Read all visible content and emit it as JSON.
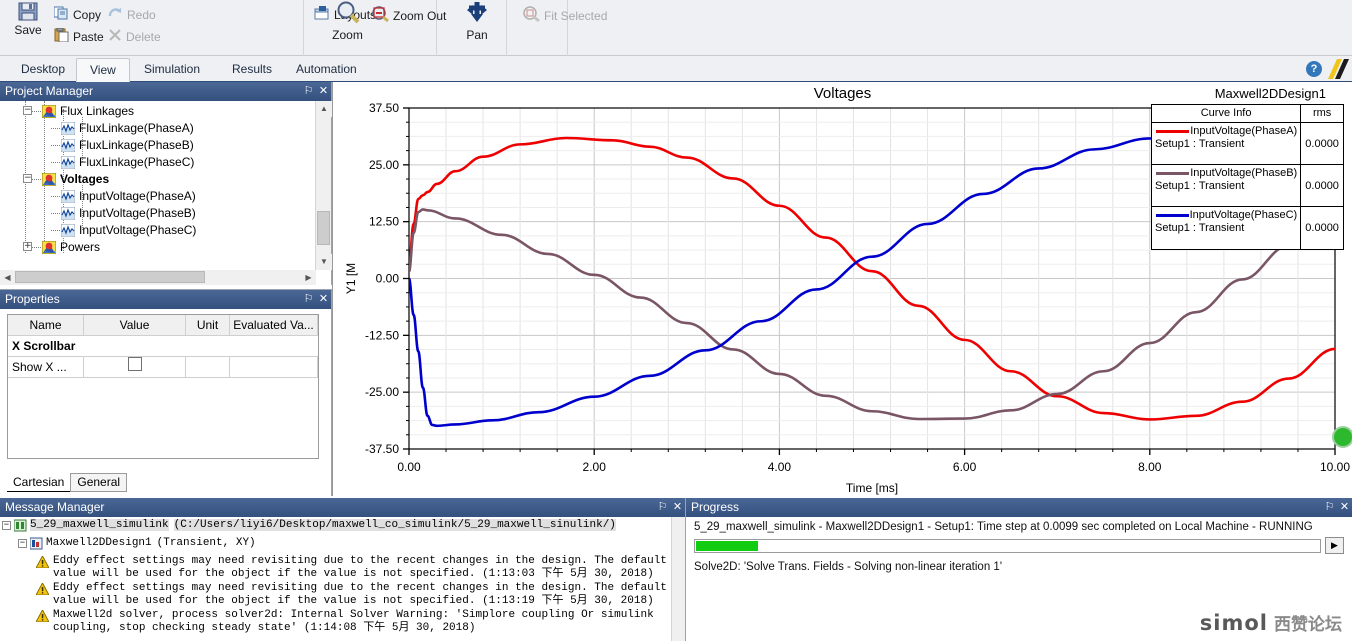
{
  "ribbon": {
    "groups": [
      {
        "name": "clipboard",
        "items": [
          {
            "label": "Save",
            "icon": "save-icon",
            "disabled": false
          },
          {
            "label": "Copy",
            "icon": "copy-icon",
            "disabled": false
          },
          {
            "label": "Redo",
            "icon": "redo-icon",
            "disabled": true
          },
          {
            "label": "Paste",
            "icon": "paste-icon",
            "disabled": false
          },
          {
            "label": "Delete",
            "icon": "delete-icon",
            "disabled": true
          }
        ]
      },
      {
        "name": "layouts",
        "items": [
          {
            "label": "Layouts",
            "icon": "layouts-icon",
            "disabled": false
          }
        ]
      },
      {
        "name": "view",
        "items": [
          {
            "label": "Zoom",
            "icon": "zoom-icon",
            "disabled": false
          },
          {
            "label": "Zoom Out",
            "icon": "zoom-out-icon",
            "disabled": false
          },
          {
            "label": "Pan",
            "icon": "pan-icon",
            "disabled": false
          },
          {
            "label": "Fit Selected",
            "icon": "fit-selected-icon",
            "disabled": true
          }
        ]
      }
    ]
  },
  "tabs": {
    "items": [
      "Desktop",
      "View",
      "Simulation",
      "Results",
      "Automation"
    ],
    "active": "View",
    "help_glyph": "?"
  },
  "project_manager": {
    "title": "Project Manager",
    "pin_glyph": "⚐",
    "close_glyph": "✕",
    "tree": [
      {
        "label": "Flux Linkages",
        "type": "folder",
        "expander": "−",
        "depth": 2,
        "bold": false
      },
      {
        "label": "FluxLinkage(PhaseA)",
        "type": "curve",
        "expander": "",
        "depth": 3,
        "bold": false
      },
      {
        "label": "FluxLinkage(PhaseB)",
        "type": "curve",
        "expander": "",
        "depth": 3,
        "bold": false
      },
      {
        "label": "FluxLinkage(PhaseC)",
        "type": "curve",
        "expander": "",
        "depth": 3,
        "bold": false
      },
      {
        "label": "Voltages",
        "type": "folder",
        "expander": "−",
        "depth": 2,
        "bold": true
      },
      {
        "label": "InputVoltage(PhaseA)",
        "type": "curve",
        "expander": "",
        "depth": 3,
        "bold": false
      },
      {
        "label": "InputVoltage(PhaseB)",
        "type": "curve",
        "expander": "",
        "depth": 3,
        "bold": false
      },
      {
        "label": "InputVoltage(PhaseC)",
        "type": "curve",
        "expander": "",
        "depth": 3,
        "bold": false
      },
      {
        "label": "Powers",
        "type": "folder",
        "expander": "+",
        "depth": 2,
        "bold": false
      }
    ]
  },
  "properties": {
    "title": "Properties",
    "pin_glyph": "⚐",
    "close_glyph": "✕",
    "columns": [
      "Name",
      "Value",
      "Unit",
      "Evaluated Va..."
    ],
    "section": "X Scrollbar",
    "rows": [
      {
        "name": "Show X ...",
        "value": "",
        "unit": "",
        "evaluated": "",
        "checkbox": true,
        "checked": false
      }
    ],
    "tabs": [
      "Cartesian",
      "General"
    ],
    "active_tab": "Cartesian"
  },
  "plot": {
    "design_name": "Maxwell2DDesign1",
    "legend": {
      "col_curve": "Curve Info",
      "col_rms": "rms",
      "rows": [
        {
          "name": "InputVoltage(PhaseA)",
          "setup": "Setup1 : Transient",
          "rms": "0.0000",
          "color": "#ee0000"
        },
        {
          "name": "InputVoltage(PhaseB)",
          "setup": "Setup1 : Transient",
          "rms": "0.0000",
          "color": "#7a5566"
        },
        {
          "name": "InputVoltage(PhaseC)",
          "setup": "Setup1 : Transient",
          "rms": "0.0000",
          "color": "#0000cc"
        }
      ]
    }
  },
  "chart_data": {
    "type": "line",
    "title": "Voltages",
    "xlabel": "Time [ms]",
    "ylabel": "Y1 [M",
    "xlim": [
      0.0,
      10.0
    ],
    "ylim": [
      -37.5,
      37.5
    ],
    "xticks": [
      "0.00",
      "2.00",
      "4.00",
      "6.00",
      "8.00",
      "10.00"
    ],
    "yticks": [
      "37.50",
      "25.00",
      "12.50",
      "0.00",
      "-12.50",
      "-25.00",
      "-37.50"
    ],
    "xtick_values": [
      0,
      2,
      4,
      6,
      8,
      10
    ],
    "ytick_values": [
      37.5,
      25,
      12.5,
      0,
      -12.5,
      -25,
      -37.5
    ],
    "grid": true,
    "legend_position": "top-right",
    "minor_ticks_x": 5,
    "minor_ticks_y": 4,
    "series": [
      {
        "name": "InputVoltage(PhaseA)",
        "color": "#ee0000",
        "amplitude": 31.0,
        "period_ms": 10.0,
        "phase_deg": 0,
        "x": [
          0.0,
          0.05,
          0.1,
          0.15,
          0.2,
          0.3,
          0.5,
          0.8,
          1.2,
          1.7,
          2.2,
          2.6,
          3.0,
          3.5,
          4.0,
          4.5,
          5.0,
          5.5,
          6.0,
          6.5,
          7.0,
          7.5,
          8.0,
          8.5,
          9.0,
          9.5,
          10.0
        ],
        "y": [
          3.2,
          12.0,
          17.5,
          18.3,
          19.0,
          20.8,
          23.6,
          26.8,
          29.5,
          30.9,
          30.4,
          29.0,
          26.6,
          22.0,
          16.0,
          9.0,
          1.6,
          -6.0,
          -13.5,
          -20.4,
          -25.9,
          -29.6,
          -31.0,
          -30.2,
          -27.1,
          -22.0,
          -15.5
        ]
      },
      {
        "name": "InputVoltage(PhaseB)",
        "color": "#7a5566",
        "amplitude": 31.0,
        "period_ms": 10.0,
        "phase_deg": -120,
        "x": [
          0.0,
          0.05,
          0.1,
          0.15,
          0.2,
          0.5,
          1.0,
          1.5,
          2.0,
          2.5,
          3.0,
          3.5,
          4.0,
          4.5,
          5.0,
          5.5,
          6.0,
          6.5,
          7.0,
          7.5,
          8.0,
          8.5,
          9.0,
          9.5,
          10.0
        ],
        "y": [
          1.5,
          10.0,
          14.6,
          15.2,
          15.0,
          13.2,
          9.6,
          5.4,
          0.8,
          -4.2,
          -9.8,
          -15.6,
          -21.0,
          -25.8,
          -29.2,
          -30.9,
          -30.8,
          -29.0,
          -25.4,
          -20.4,
          -14.2,
          -7.4,
          -0.2,
          7.2,
          14.2
        ]
      },
      {
        "name": "InputVoltage(PhaseC)",
        "color": "#0000cc",
        "amplitude": 31.0,
        "period_ms": 10.0,
        "phase_deg": 120,
        "x": [
          0.0,
          0.05,
          0.1,
          0.15,
          0.2,
          0.25,
          0.3,
          0.5,
          0.9,
          1.4,
          2.0,
          2.6,
          3.2,
          3.8,
          4.4,
          5.0,
          5.6,
          6.2,
          6.8,
          7.4,
          8.0,
          8.6,
          9.2,
          9.6,
          10.0
        ],
        "y": [
          0.0,
          -8.0,
          -16.0,
          -24.0,
          -30.2,
          -32.2,
          -32.4,
          -32.1,
          -31.2,
          -29.4,
          -26.0,
          -21.4,
          -15.8,
          -9.4,
          -2.4,
          4.8,
          12.0,
          18.6,
          24.2,
          28.4,
          30.8,
          31.0,
          29.4,
          27.4,
          24.4
        ]
      }
    ]
  },
  "message_manager": {
    "title": "Message Manager",
    "pin_glyph": "⚐",
    "close_glyph": "✕",
    "root": {
      "expander": "−",
      "name": "5_29_maxwell_simulink",
      "path": "(C:/Users/liyi6/Desktop/maxwell_co_simulink/5_29_maxwell_sinulink/)"
    },
    "design": {
      "expander": "−",
      "name": "Maxwell2DDesign1",
      "detail": "(Transient, XY)"
    },
    "messages": [
      {
        "icon": "warning-icon",
        "line1": "Eddy effect settings may need revisiting due to the recent changes in the design.  The default",
        "line2": "value will be used for the object if the value is not specified.  (1:13:03 下午  5月 30, 2018)"
      },
      {
        "icon": "warning-icon",
        "line1": "Eddy effect settings may need revisiting due to the recent changes in the design.  The default",
        "line2": "value will be used for the object if the value is not specified.  (1:13:19 下午  5月 30, 2018)"
      },
      {
        "icon": "warning-icon",
        "line1": "Maxwell2d solver, process solver2d: Internal Solver Warning: 'Simplore coupling Or simulink",
        "line2": "coupling, stop checking steady state' (1:14:08 下午  5月 30, 2018)"
      }
    ]
  },
  "progress": {
    "title": "Progress",
    "pin_glyph": "⚐",
    "close_glyph": "✕",
    "headline": "5_29_maxwell_simulink - Maxwell2DDesign1 - Setup1: Time step at 0.0099 sec completed on Local Machine - RUNNING",
    "bar_percent": 10,
    "bar_color": "#12cc12",
    "next_glyph": "▶",
    "status": "Solve2D: 'Solve Trans. Fields - Solving non-linear iteration 1'"
  },
  "watermark": {
    "brand": "simol",
    "cn": "西赞论坛"
  }
}
